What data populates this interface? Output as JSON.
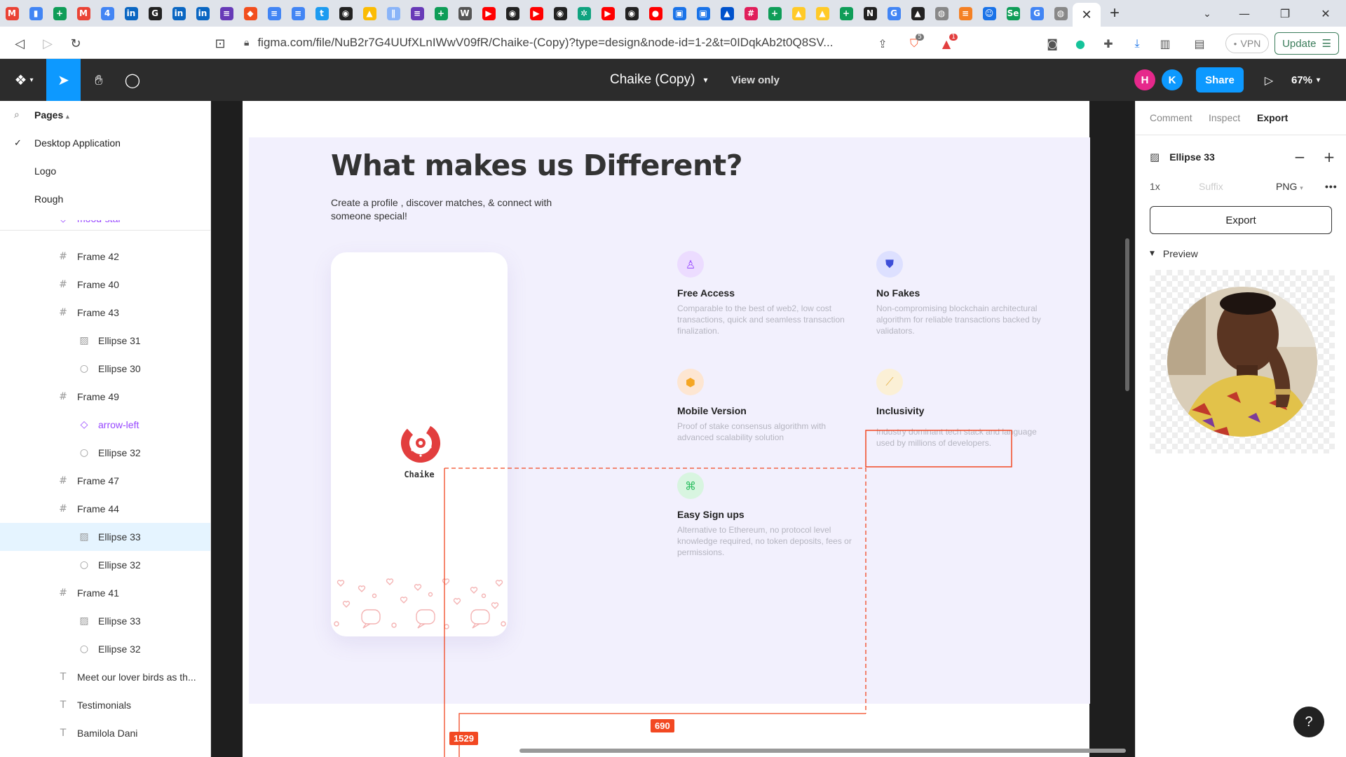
{
  "browser": {
    "tab_icons": [
      {
        "icon": "gmail-icon",
        "color": "#ea4335",
        "glyph": "M"
      },
      {
        "icon": "docs-icon",
        "color": "#4285f4",
        "glyph": "▮"
      },
      {
        "icon": "sheets-icon",
        "color": "#0f9d58",
        "glyph": "+"
      },
      {
        "icon": "gmail-icon",
        "color": "#ea4335",
        "glyph": "M"
      },
      {
        "icon": "calendar-icon",
        "color": "#4285f4",
        "glyph": "4"
      },
      {
        "icon": "linkedin-icon",
        "color": "#0a66c2",
        "glyph": "in"
      },
      {
        "icon": "grammarly-icon",
        "color": "#222222",
        "glyph": "G"
      },
      {
        "icon": "linkedin-icon",
        "color": "#0a66c2",
        "glyph": "in"
      },
      {
        "icon": "linkedin-icon",
        "color": "#0a66c2",
        "glyph": "in"
      },
      {
        "icon": "forms-icon",
        "color": "#673ab7",
        "glyph": "≡"
      },
      {
        "icon": "figma-icon",
        "color": "#f24e1e",
        "glyph": "◆"
      },
      {
        "icon": "docs-icon",
        "color": "#4285f4",
        "glyph": "≡"
      },
      {
        "icon": "docs-icon",
        "color": "#4285f4",
        "glyph": "≡"
      },
      {
        "icon": "twitter-icon",
        "color": "#1d9bf0",
        "glyph": "t"
      },
      {
        "icon": "github-icon",
        "color": "#222222",
        "glyph": "◉"
      },
      {
        "icon": "drive-icon",
        "color": "#fbbc04",
        "glyph": "▲"
      },
      {
        "icon": "audio-icon",
        "color": "#8ab4f8",
        "glyph": "∥"
      },
      {
        "icon": "forms-icon",
        "color": "#673ab7",
        "glyph": "≡"
      },
      {
        "icon": "sheets-icon",
        "color": "#0f9d58",
        "glyph": "+"
      },
      {
        "icon": "wiki-icon",
        "color": "#555555",
        "glyph": "W"
      },
      {
        "icon": "youtube-icon",
        "color": "#ff0000",
        "glyph": "▶"
      },
      {
        "icon": "github-icon",
        "color": "#222222",
        "glyph": "◉"
      },
      {
        "icon": "youtube-icon",
        "color": "#ff0000",
        "glyph": "▶"
      },
      {
        "icon": "github-icon",
        "color": "#222222",
        "glyph": "◉"
      },
      {
        "icon": "chatgpt-icon",
        "color": "#10a37f",
        "glyph": "✲"
      },
      {
        "icon": "youtube-icon",
        "color": "#ff0000",
        "glyph": "▶"
      },
      {
        "icon": "github-icon",
        "color": "#222222",
        "glyph": "◉"
      },
      {
        "icon": "youtube-music-icon",
        "color": "#ff0000",
        "glyph": "●"
      },
      {
        "icon": "bookmark-icon",
        "color": "#1a73e8",
        "glyph": "▣"
      },
      {
        "icon": "bookmark-icon",
        "color": "#1a73e8",
        "glyph": "▣"
      },
      {
        "icon": "atlassian-icon",
        "color": "#0052cc",
        "glyph": "▲"
      },
      {
        "icon": "slack-icon",
        "color": "#e01e5a",
        "glyph": "#"
      },
      {
        "icon": "sheets-icon",
        "color": "#0f9d58",
        "glyph": "+"
      },
      {
        "icon": "firebase-icon",
        "color": "#ffca28",
        "glyph": "▲"
      },
      {
        "icon": "firebase-icon",
        "color": "#ffca28",
        "glyph": "▲"
      },
      {
        "icon": "sheets-icon",
        "color": "#0f9d58",
        "glyph": "+"
      },
      {
        "icon": "notion-icon",
        "color": "#222222",
        "glyph": "N"
      },
      {
        "icon": "google-icon",
        "color": "#4285f4",
        "glyph": "G"
      },
      {
        "icon": "vercel-icon",
        "color": "#222222",
        "glyph": "▲"
      },
      {
        "icon": "globe-icon",
        "color": "#888888",
        "glyph": "◍"
      },
      {
        "icon": "stackoverflow-icon",
        "color": "#f48024",
        "glyph": "≡"
      },
      {
        "icon": "reddit-icon",
        "color": "#1a73e8",
        "glyph": "☺"
      },
      {
        "icon": "se-icon",
        "color": "#0f9d58",
        "glyph": "Se"
      },
      {
        "icon": "google-icon",
        "color": "#4285f4",
        "glyph": "G"
      },
      {
        "icon": "globe-icon",
        "color": "#888888",
        "glyph": "◍"
      }
    ],
    "active_tab_close": "✕",
    "new_tab": "+",
    "tab_dropdown": "⌄",
    "window_controls": {
      "minimize": "—",
      "maximize": "❐",
      "close": "✕"
    },
    "nav": {
      "back": "◁",
      "forward": "▷",
      "reload": "↻",
      "bookmark": "⊡"
    },
    "url": "figma.com/file/NuB2r7G4UUfXLnIWwV09fR/Chaike-(Copy)?type=design&node-id=1-2&t=0IDqkAb2t0Q8SV...",
    "brave_badge": "5",
    "alert_badge": "1",
    "vpn_label": "VPN",
    "update_label": "Update"
  },
  "figma": {
    "file_title": "Chaike (Copy)",
    "mode": "View only",
    "avatars": [
      {
        "letter": "H",
        "color": "#e6288b"
      },
      {
        "letter": "K",
        "color": "#0d99ff"
      }
    ],
    "share_label": "Share",
    "zoom": "67%"
  },
  "left_panel": {
    "pages_title": "Pages",
    "pages": [
      {
        "name": "Desktop Application",
        "selected": true
      },
      {
        "name": "Logo",
        "selected": false
      },
      {
        "name": "Rough",
        "selected": false
      }
    ],
    "cut_off_layer": "mood-star",
    "layers": [
      {
        "name": "Frame 42",
        "type": "frame",
        "depth": 0
      },
      {
        "name": "Frame 40",
        "type": "frame",
        "depth": 0
      },
      {
        "name": "Frame 43",
        "type": "frame",
        "depth": 0
      },
      {
        "name": "Ellipse 31",
        "type": "image",
        "depth": 1
      },
      {
        "name": "Ellipse 30",
        "type": "ellipse",
        "depth": 1
      },
      {
        "name": "Frame 49",
        "type": "frame",
        "depth": 0
      },
      {
        "name": "arrow-left",
        "type": "component",
        "depth": 1
      },
      {
        "name": "Ellipse 32",
        "type": "ellipse",
        "depth": 1
      },
      {
        "name": "Frame 47",
        "type": "frame",
        "depth": 0
      },
      {
        "name": "Frame 44",
        "type": "frame",
        "depth": 0
      },
      {
        "name": "Ellipse 33",
        "type": "image",
        "depth": 1,
        "selected": true
      },
      {
        "name": "Ellipse 32",
        "type": "ellipse",
        "depth": 1
      },
      {
        "name": "Frame 41",
        "type": "frame",
        "depth": 0
      },
      {
        "name": "Ellipse 33",
        "type": "image",
        "depth": 1
      },
      {
        "name": "Ellipse 32",
        "type": "ellipse",
        "depth": 1
      },
      {
        "name": "Meet our lover birds as th...",
        "type": "text",
        "depth": 0
      },
      {
        "name": "Testimonials",
        "type": "text",
        "depth": 0
      },
      {
        "name": "Bamilola Dani",
        "type": "text",
        "depth": 0
      }
    ]
  },
  "design": {
    "heading": "What makes us Different?",
    "subheading": "Create a profile , discover matches, & connect with someone special!",
    "app_name": "Chaike",
    "brand_color": "#e23e3e",
    "features": [
      {
        "title": "Free Access",
        "icon": "user-icon",
        "glyph": "♙",
        "icon_bg": "#ecdcff",
        "icon_color": "#9747ff",
        "desc": "Comparable to the best of web2, low cost transactions, quick and seamless transaction finalization."
      },
      {
        "title": "No Fakes",
        "icon": "shield-icon",
        "glyph": "⛊",
        "icon_bg": "#dde0ff",
        "icon_color": "#3d4ed8",
        "desc": "Non-compromising blockchain architectural algorithm for reliable transactions backed by validators."
      },
      {
        "title": "Mobile Version",
        "icon": "cube-icon",
        "glyph": "⬢",
        "icon_bg": "#fde6d2",
        "icon_color": "#f5a623",
        "desc": "Proof of stake consensus algorithm with advanced scalability solution"
      },
      {
        "title": "Inclusivity",
        "icon": "chart-icon",
        "glyph": "⟋",
        "icon_bg": "#fbf0d6",
        "icon_color": "#e6b24a",
        "desc": "Industry dominant tech stack and language used by millions of developers."
      },
      {
        "title": "Easy Sign ups",
        "icon": "scan-icon",
        "glyph": "⌘",
        "icon_bg": "#d8f5e0",
        "icon_color": "#2fbf63",
        "desc": "Alternative to Ethereum, no protocol level knowledge required, no token deposits, fees or permissions."
      }
    ],
    "measurements": {
      "vertical": "1529",
      "horizontal": "690"
    }
  },
  "right_panel": {
    "tabs": [
      {
        "label": "Comment",
        "active": false
      },
      {
        "label": "Inspect",
        "active": false
      },
      {
        "label": "Export",
        "active": true
      }
    ],
    "layer_name": "Ellipse 33",
    "scale": "1x",
    "suffix_placeholder": "Suffix",
    "format": "PNG",
    "more": "•••",
    "export_label": "Export",
    "preview_label": "Preview"
  },
  "help_label": "?"
}
